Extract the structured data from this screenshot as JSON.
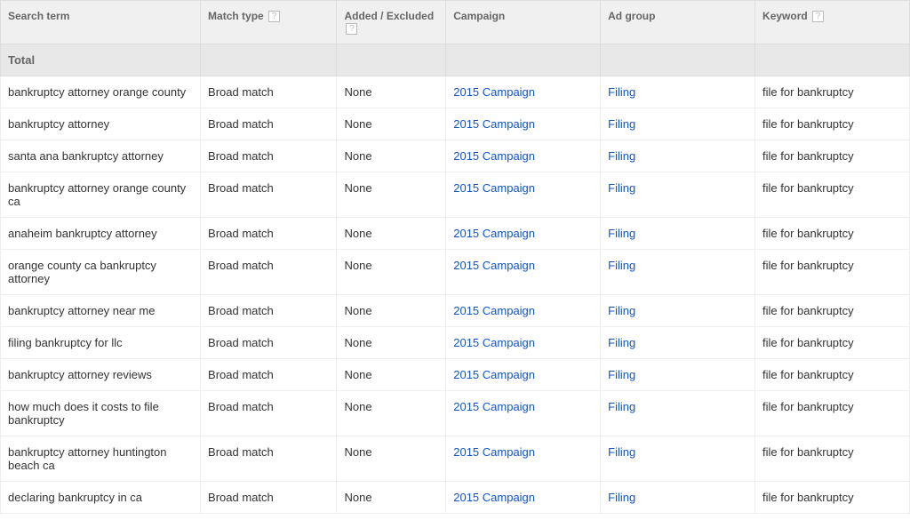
{
  "headers": {
    "search_term": "Search term",
    "match_type": "Match type",
    "added_excluded": "Added / Excluded",
    "campaign": "Campaign",
    "ad_group": "Ad group",
    "keyword": "Keyword"
  },
  "help_icon": "?",
  "total_label": "Total",
  "rows": [
    {
      "search_term": "bankruptcy attorney orange county",
      "match_type": "Broad match",
      "added_excluded": "None",
      "campaign": "2015 Campaign",
      "ad_group": "Filing",
      "keyword": "file for bankruptcy"
    },
    {
      "search_term": "bankruptcy attorney",
      "match_type": "Broad match",
      "added_excluded": "None",
      "campaign": "2015 Campaign",
      "ad_group": "Filing",
      "keyword": "file for bankruptcy"
    },
    {
      "search_term": "santa ana bankruptcy attorney",
      "match_type": "Broad match",
      "added_excluded": "None",
      "campaign": "2015 Campaign",
      "ad_group": "Filing",
      "keyword": "file for bankruptcy"
    },
    {
      "search_term": "bankruptcy attorney orange county ca",
      "match_type": "Broad match",
      "added_excluded": "None",
      "campaign": "2015 Campaign",
      "ad_group": "Filing",
      "keyword": "file for bankruptcy"
    },
    {
      "search_term": "anaheim bankruptcy attorney",
      "match_type": "Broad match",
      "added_excluded": "None",
      "campaign": "2015 Campaign",
      "ad_group": "Filing",
      "keyword": "file for bankruptcy"
    },
    {
      "search_term": "orange county ca bankruptcy attorney",
      "match_type": "Broad match",
      "added_excluded": "None",
      "campaign": "2015 Campaign",
      "ad_group": "Filing",
      "keyword": "file for bankruptcy"
    },
    {
      "search_term": "bankruptcy attorney near me",
      "match_type": "Broad match",
      "added_excluded": "None",
      "campaign": "2015 Campaign",
      "ad_group": "Filing",
      "keyword": "file for bankruptcy"
    },
    {
      "search_term": "filing bankruptcy for llc",
      "match_type": "Broad match",
      "added_excluded": "None",
      "campaign": "2015 Campaign",
      "ad_group": "Filing",
      "keyword": "file for bankruptcy"
    },
    {
      "search_term": "bankruptcy attorney reviews",
      "match_type": "Broad match",
      "added_excluded": "None",
      "campaign": "2015 Campaign",
      "ad_group": "Filing",
      "keyword": "file for bankruptcy"
    },
    {
      "search_term": "how much does it costs to file bankruptcy",
      "match_type": "Broad match",
      "added_excluded": "None",
      "campaign": "2015 Campaign",
      "ad_group": "Filing",
      "keyword": "file for bankruptcy"
    },
    {
      "search_term": "bankruptcy attorney huntington beach ca",
      "match_type": "Broad match",
      "added_excluded": "None",
      "campaign": "2015 Campaign",
      "ad_group": "Filing",
      "keyword": "file for bankruptcy"
    },
    {
      "search_term": "declaring bankruptcy in ca",
      "match_type": "Broad match",
      "added_excluded": "None",
      "campaign": "2015 Campaign",
      "ad_group": "Filing",
      "keyword": "file for bankruptcy"
    }
  ]
}
